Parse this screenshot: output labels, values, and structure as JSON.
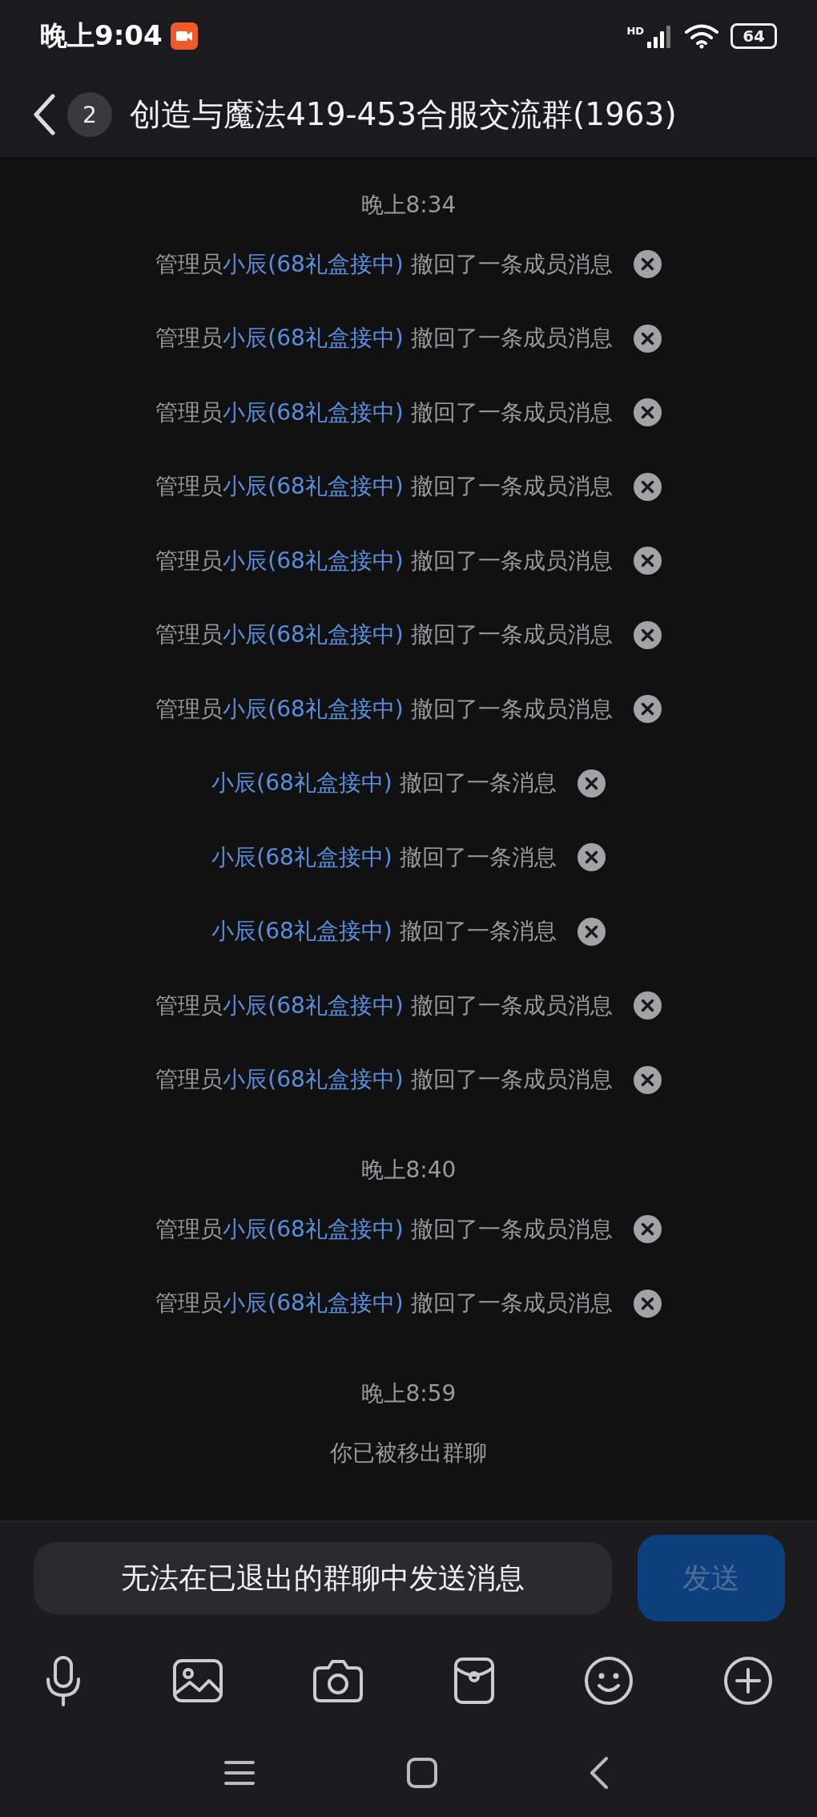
{
  "status_bar": {
    "time": "晚上9:04",
    "network": "HD",
    "battery": "64"
  },
  "header": {
    "unread_badge": "2",
    "title": "创造与魔法419-453合服交流群(1963)"
  },
  "groups": [
    {
      "time": "晚上8:34",
      "messages": [
        {
          "kind": "recall",
          "prefix": "管理员",
          "name": "小辰(68礼盒接中)",
          "text": "撤回了一条成员消息"
        },
        {
          "kind": "recall",
          "prefix": "管理员",
          "name": "小辰(68礼盒接中)",
          "text": "撤回了一条成员消息"
        },
        {
          "kind": "recall",
          "prefix": "管理员",
          "name": "小辰(68礼盒接中)",
          "text": "撤回了一条成员消息"
        },
        {
          "kind": "recall",
          "prefix": "管理员",
          "name": "小辰(68礼盒接中)",
          "text": "撤回了一条成员消息"
        },
        {
          "kind": "recall",
          "prefix": "管理员",
          "name": "小辰(68礼盒接中)",
          "text": "撤回了一条成员消息"
        },
        {
          "kind": "recall",
          "prefix": "管理员",
          "name": "小辰(68礼盒接中)",
          "text": "撤回了一条成员消息"
        },
        {
          "kind": "recall",
          "prefix": "管理员",
          "name": "小辰(68礼盒接中)",
          "text": "撤回了一条成员消息"
        },
        {
          "kind": "recall",
          "name": "小辰(68礼盒接中)",
          "text": "撤回了一条消息"
        },
        {
          "kind": "recall",
          "name": "小辰(68礼盒接中)",
          "text": "撤回了一条消息"
        },
        {
          "kind": "recall",
          "name": "小辰(68礼盒接中)",
          "text": "撤回了一条消息"
        },
        {
          "kind": "recall",
          "prefix": "管理员",
          "name": "小辰(68礼盒接中)",
          "text": "撤回了一条成员消息"
        },
        {
          "kind": "recall",
          "prefix": "管理员",
          "name": "小辰(68礼盒接中)",
          "text": "撤回了一条成员消息"
        }
      ]
    },
    {
      "time": "晚上8:40",
      "messages": [
        {
          "kind": "recall",
          "prefix": "管理员",
          "name": "小辰(68礼盒接中)",
          "text": "撤回了一条成员消息"
        },
        {
          "kind": "recall",
          "prefix": "管理员",
          "name": "小辰(68礼盒接中)",
          "text": "撤回了一条成员消息"
        }
      ]
    },
    {
      "time": "晚上8:59",
      "messages": [
        {
          "kind": "notice",
          "text": "你已被移出群聊"
        }
      ]
    }
  ],
  "composer": {
    "input_text": "无法在已退出的群聊中发送消息",
    "send_label": "发送",
    "send_disabled": true
  }
}
